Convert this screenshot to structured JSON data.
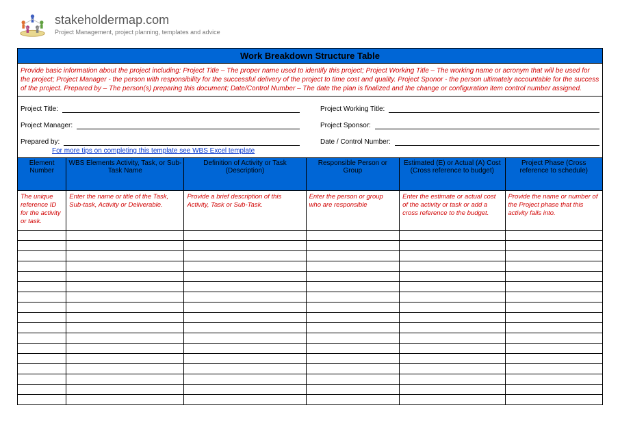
{
  "brand": {
    "name": "stakeholdermap.com",
    "tagline": "Project Management, project planning, templates and advice"
  },
  "doc": {
    "title": "Work Breakdown Structure Table",
    "instructions": "Provide basic information about the project including: Project Title – The proper name used to identify this project; Project Working Title – The working name or acronym that will be used for the project;  Project Manager - the person with responsibility for the successful delivery of the project to time cost and quality. Project Sponor - the person ultimately accountable for the success of the project. Prepared by – The person(s) preparing this document; Date/Control Number – The date the plan is finalized and the change or configuration item control number assigned.",
    "fields": {
      "project_title": "Project Title:",
      "working_title": "Project Working Title:",
      "project_manager": "Project Manager:",
      "sponsor": "Project Sponsor:",
      "prepared_by": "Prepared by:",
      "date_control": "Date / Control Number:"
    },
    "link_text": "For more tips on completing this template see WBS Excel template"
  },
  "columns": [
    "Element Number",
    "WBS Elements\nActivity, Task, or Sub-Task Name",
    "Definition of Activity or Task (Description)",
    "Responsible Person or Group",
    "Estimated (E) or Actual (A) Cost (Cross reference to budget)",
    "Project Phase (Cross reference to schedule)"
  ],
  "hints": [
    "The unique reference ID for the activity or task.",
    "Enter the name or title of the Task, Sub-task, Activity or Deliverable.",
    "Provide a brief description of this Activity, Task or Sub-Task.",
    "Enter the person or group who are responsible",
    "Enter the estimate or actual cost of the activity or task or add a cross reference to the budget.",
    "Provide the name or number of the Project phase that this activity falls into."
  ],
  "empty_rows": 17
}
